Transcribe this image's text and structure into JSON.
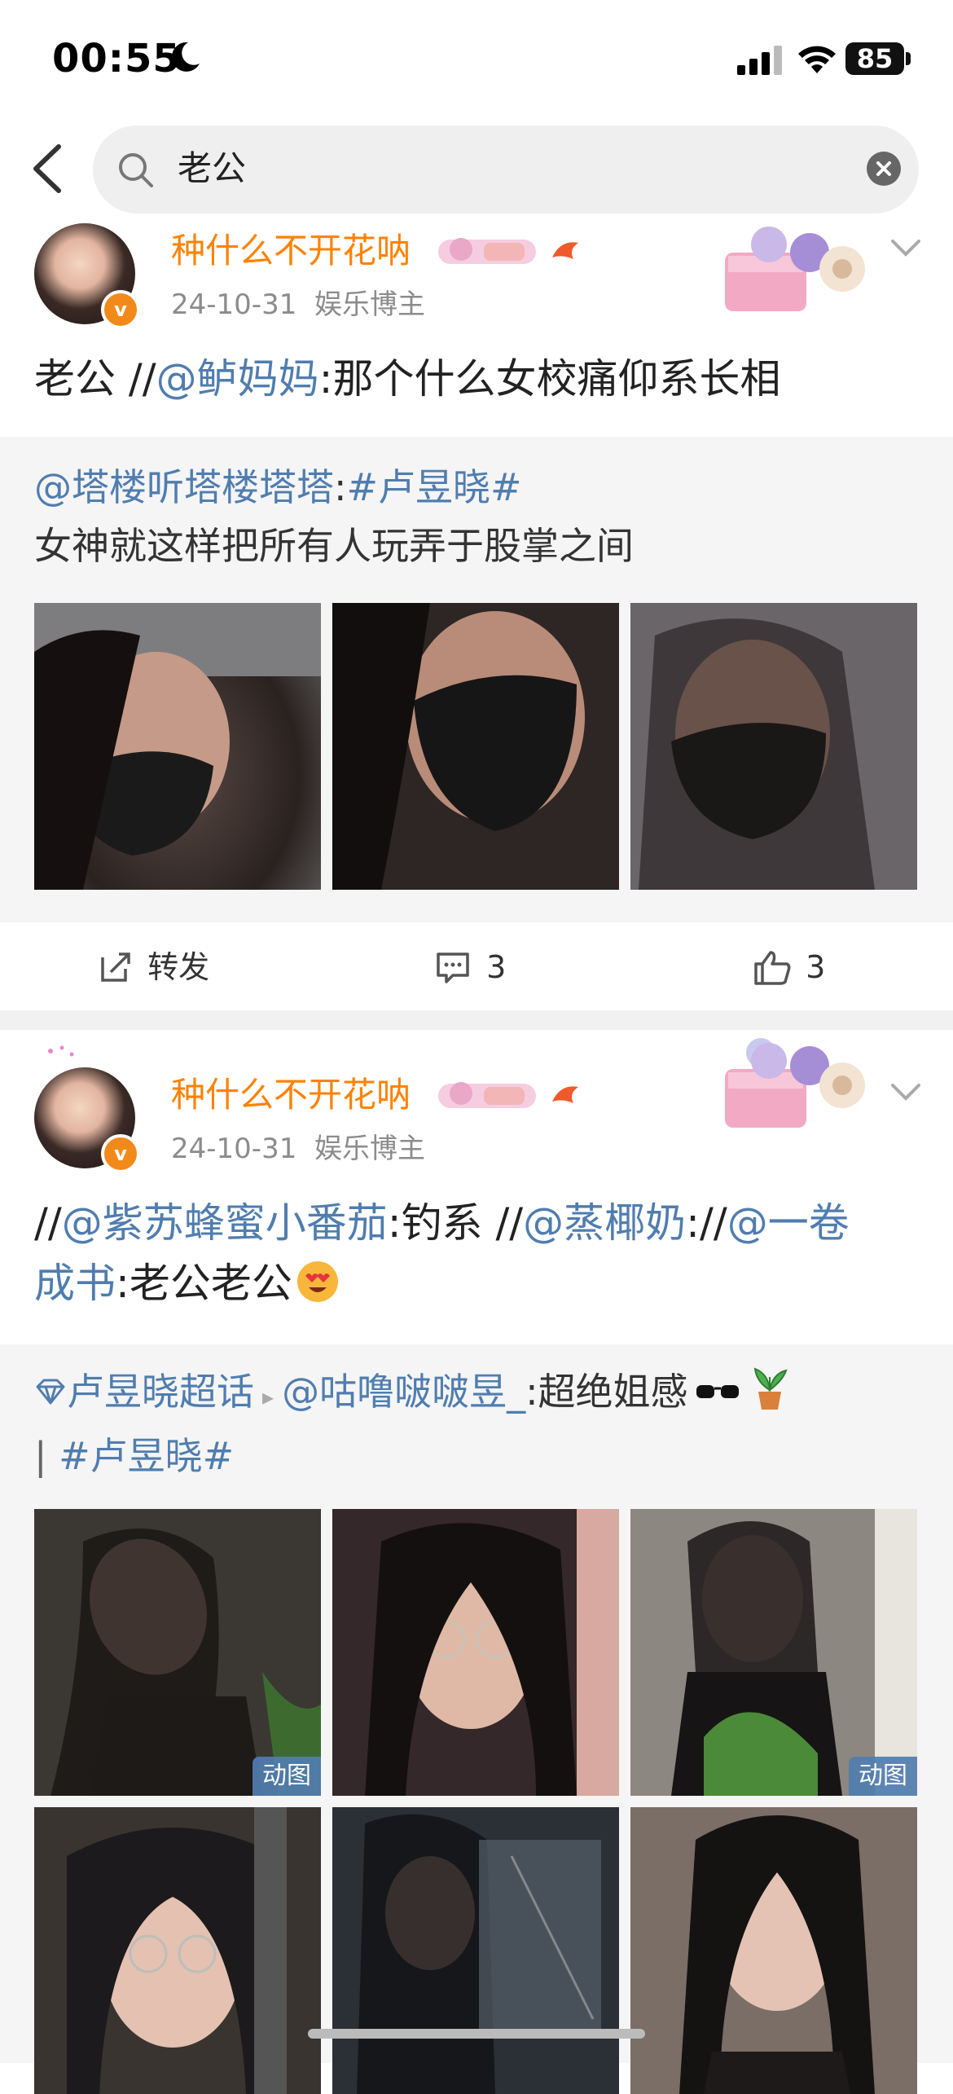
{
  "status_bar": {
    "time": "00:55",
    "battery": "85"
  },
  "search": {
    "query": "老公"
  },
  "posts": [
    {
      "username": "种什么不开花呐",
      "date": "24-10-31",
      "role": "娱乐博主",
      "text_parts": [
        "老公 //",
        "@鲈妈妈",
        ":那个什么女校痛仰系长相"
      ],
      "repost": {
        "line1_parts": [
          "@塔楼听塔楼塔塔",
          ":",
          "#卢昱晓#"
        ],
        "line2": "女神就这样把所有人玩弄于股掌之间"
      },
      "actions": {
        "repost_label": "转发",
        "comments": "3",
        "likes": "3"
      }
    },
    {
      "username": "种什么不开花呐",
      "date": "24-10-31",
      "role": "娱乐博主",
      "text_parts": [
        "//",
        "@紫苏蜂蜜小番茄",
        ":钓系 //",
        "@蒸椰奶",
        "://",
        "@一卷",
        "成书",
        ":老公老公"
      ],
      "repost": {
        "supertopic": "卢昱晓超话",
        "line1_parts": [
          "@咕噜啵啵昱_",
          ":超绝姐感"
        ],
        "line2_parts": [
          "| ",
          "#卢昱晓#"
        ]
      },
      "gif_label": "动图"
    }
  ],
  "colors": {
    "username": "#ff8200",
    "link": "#507daf",
    "meta": "#8c8c8c",
    "repost_bg": "#f5f5f5"
  },
  "icons": [
    "back-icon",
    "search-icon",
    "clear-icon",
    "verified-icon",
    "chevron-down-icon",
    "repost-icon",
    "comment-icon",
    "like-icon",
    "supertopic-icon"
  ]
}
